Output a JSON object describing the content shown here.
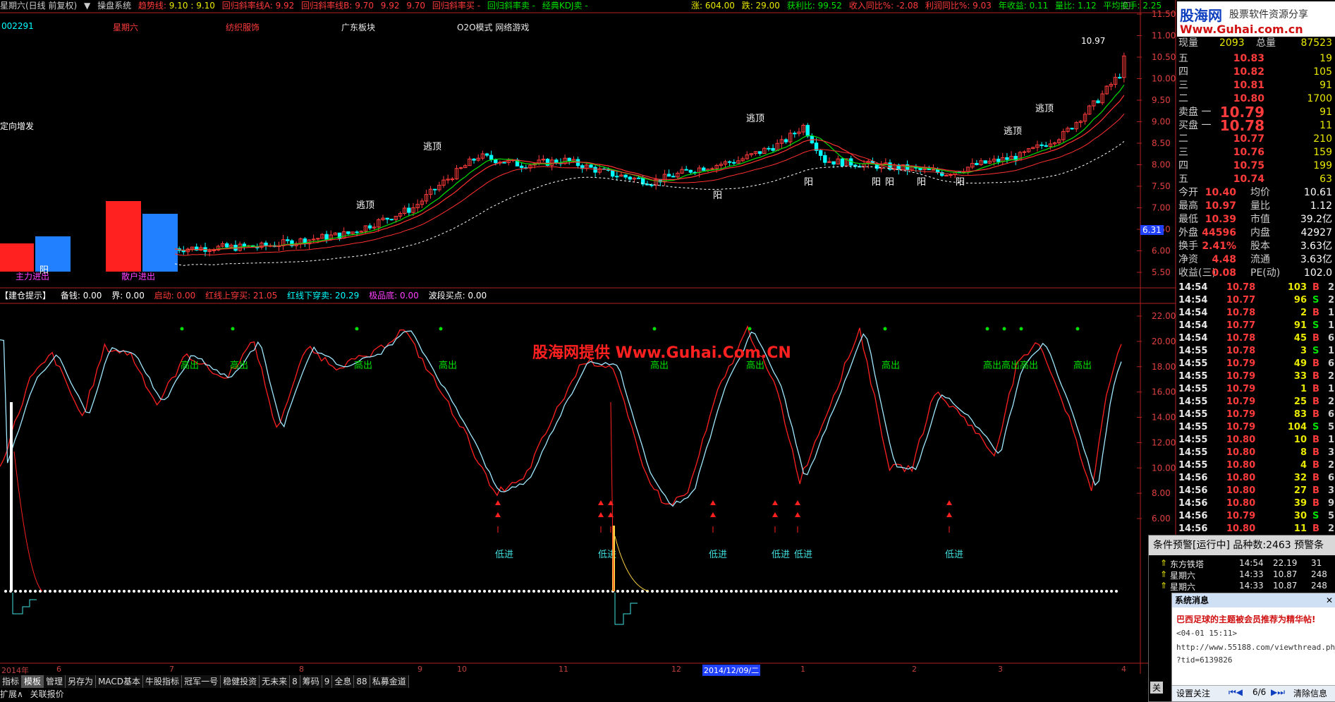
{
  "topbar": {
    "title": "星期六(日线 前复权)",
    "system": "操盘系统",
    "trend_label": "趋势线:",
    "trend_val": "9.10 : 9.10",
    "reg_a": "回归斜率线A: 9.92",
    "reg_b": "回归斜率线B: 9.70",
    "reg_c": "9.92",
    "reg_d": "9.70",
    "buy1": "回归斜率买 -",
    "buy2": "回归斜率卖 -",
    "kdj": "经典KDJ卖 -",
    "rise": "涨: 604.00",
    "fall": "跌: 29.00",
    "profit": "获利比: 99.52",
    "rev": "收入同比%: -2.08",
    "prof": "利润同比%: 9.03",
    "eps": "年收益: 0.11",
    "vol_ratio": "量比: 1.12",
    "turnover": "平均换手: 2.25"
  },
  "sectors": {
    "code": "002291",
    "name": "星期六",
    "industry": "纺织服饰",
    "region": "广东板块",
    "concept": "O2O模式 网络游戏"
  },
  "chart_text": {
    "dingxiang": "定向增发",
    "zhuli": "主力进出",
    "sanhu": "散户进出",
    "max_price": "10.97",
    "min_label": "6.31",
    "watermark": "股海网提供 Www.Guhai.Com.CN",
    "taoding": "逃顶",
    "yang": "阳",
    "gaochu": "高出",
    "dijin": "低进"
  },
  "price_axis": [
    "11.50",
    "11.00",
    "10.50",
    "10.00",
    "9.50",
    "9.00",
    "8.50",
    "8.00",
    "7.50",
    "7.00",
    "6.50",
    "6.00",
    "5.50"
  ],
  "ind_axis": [
    "22.00",
    "20.00",
    "18.00",
    "16.00",
    "14.00",
    "12.00",
    "10.00",
    "8.00",
    "6.00"
  ],
  "indicator_bar": {
    "name": "【建仓提示】",
    "beiqian": "备钱: 0.00",
    "jie": "界: 0.00",
    "qidong": "启动: 0.00",
    "red_up": "红线上穿买: 21.05",
    "red_down": "红线下穿卖: 20.29",
    "jipin": "极品底: 0.00",
    "boduan": "波段买点: 0.00"
  },
  "xaxis": [
    "2014年",
    "6",
    "7",
    "8",
    "9",
    "10",
    "11",
    "12",
    "2014/12/09/二",
    "1",
    "2",
    "3",
    "4"
  ],
  "bottom_tabs": [
    "指标",
    "模板",
    "管理",
    "另存为",
    "MACD基本",
    "牛股指标",
    "冠军一号",
    "稳健投资",
    "无未来",
    "8",
    "筹码",
    "9",
    "全息",
    "88",
    "私募金道"
  ],
  "bottom_row2": [
    "扩展∧",
    "关联报价"
  ],
  "logo": {
    "line1": "股海网",
    "line2": "股票软件资源分享",
    "line3": "Www.Guhai.com.cn"
  },
  "quote": {
    "xianliang": {
      "label": "现量",
      "val": "2093",
      "label2": "总量",
      "val2": "87523"
    },
    "sell": [
      {
        "label": "五",
        "price": "10.83",
        "vol": "19"
      },
      {
        "label": "四",
        "price": "10.82",
        "vol": "105"
      },
      {
        "label": "三",
        "price": "10.81",
        "vol": "91"
      },
      {
        "label": "二",
        "price": "10.80",
        "vol": "1700"
      },
      {
        "label": "卖盘 一",
        "price": "10.79",
        "vol": "91"
      }
    ],
    "buy": [
      {
        "label": "买盘 一",
        "price": "10.78",
        "vol": "11"
      },
      {
        "label": "二",
        "price": "10.77",
        "vol": "210"
      },
      {
        "label": "三",
        "price": "10.76",
        "vol": "159"
      },
      {
        "label": "四",
        "price": "10.75",
        "vol": "199"
      },
      {
        "label": "五",
        "price": "10.74",
        "vol": "63"
      }
    ],
    "stats": [
      {
        "l": "今开",
        "v": "10.40",
        "l2": "均价",
        "v2": "10.61"
      },
      {
        "l": "最高",
        "v": "10.97",
        "l2": "量比",
        "v2": "1.12"
      },
      {
        "l": "最低",
        "v": "10.39",
        "l2": "市值",
        "v2": "39.2亿"
      },
      {
        "l": "外盘",
        "v": "44596",
        "l2": "内盘",
        "v2": "42927"
      },
      {
        "l": "换手",
        "v": "2.41%",
        "l2": "股本",
        "v2": "3.63亿"
      },
      {
        "l": "净资",
        "v": "4.48",
        "l2": "流通",
        "v2": "3.63亿"
      },
      {
        "l": "收益(三)",
        "v": "0.08",
        "l2": "PE(动)",
        "v2": "102.0"
      }
    ]
  },
  "ticks": [
    {
      "t": "14:54",
      "p": "10.78",
      "v": "103",
      "d": "B",
      "n": "2"
    },
    {
      "t": "14:54",
      "p": "10.77",
      "v": "96",
      "d": "S",
      "n": "2"
    },
    {
      "t": "14:54",
      "p": "10.78",
      "v": "2",
      "d": "B",
      "n": "1"
    },
    {
      "t": "14:54",
      "p": "10.77",
      "v": "91",
      "d": "S",
      "n": "1"
    },
    {
      "t": "14:54",
      "p": "10.78",
      "v": "45",
      "d": "B",
      "n": "6"
    },
    {
      "t": "14:55",
      "p": "10.78",
      "v": "3",
      "d": "S",
      "n": "1"
    },
    {
      "t": "14:55",
      "p": "10.79",
      "v": "49",
      "d": "B",
      "n": "6"
    },
    {
      "t": "14:55",
      "p": "10.79",
      "v": "33",
      "d": "B",
      "n": "2"
    },
    {
      "t": "14:55",
      "p": "10.79",
      "v": "1",
      "d": "B",
      "n": "1"
    },
    {
      "t": "14:55",
      "p": "10.79",
      "v": "25",
      "d": "B",
      "n": "2"
    },
    {
      "t": "14:55",
      "p": "10.79",
      "v": "83",
      "d": "B",
      "n": "6"
    },
    {
      "t": "14:55",
      "p": "10.79",
      "v": "104",
      "d": "S",
      "n": "5"
    },
    {
      "t": "14:55",
      "p": "10.80",
      "v": "10",
      "d": "B",
      "n": "1"
    },
    {
      "t": "14:55",
      "p": "10.80",
      "v": "8",
      "d": "B",
      "n": "3"
    },
    {
      "t": "14:55",
      "p": "10.80",
      "v": "4",
      "d": "B",
      "n": "2"
    },
    {
      "t": "14:56",
      "p": "10.80",
      "v": "32",
      "d": "B",
      "n": "6"
    },
    {
      "t": "14:56",
      "p": "10.80",
      "v": "27",
      "d": "B",
      "n": "3"
    },
    {
      "t": "14:56",
      "p": "10.80",
      "v": "39",
      "d": "B",
      "n": "9"
    },
    {
      "t": "14:56",
      "p": "10.79",
      "v": "30",
      "d": "S",
      "n": "5"
    },
    {
      "t": "14:56",
      "p": "10.80",
      "v": "11",
      "d": "B",
      "n": "2"
    }
  ],
  "alert": {
    "title": "条件预警[运行中] 品种数:2463 预警条",
    "rows": [
      {
        "name": "东方铁塔",
        "time": "14:54",
        "price": "22.19",
        "n": "31"
      },
      {
        "name": "星期六",
        "time": "14:33",
        "price": "10.87",
        "n": "248"
      },
      {
        "name": "星期六",
        "time": "14:33",
        "price": "10.87",
        "n": "248"
      }
    ],
    "left_btn": "关"
  },
  "sysmsg": {
    "title": "系统消息",
    "close": "✕",
    "headline": "巴西足球的主题被会员推荐为精华帖!",
    "date": "<04-01 15:11>",
    "url1": "http://www.55188.com/viewthread.php",
    "url2": "?tid=6139826",
    "setting": "设置关注",
    "page": "6/6",
    "clear": "清除信息"
  },
  "colors": {
    "up": "#ff3b3b",
    "down": "#00ffff",
    "green": "#00e000",
    "yellow": "#e8e800",
    "frame": "#b02020"
  }
}
